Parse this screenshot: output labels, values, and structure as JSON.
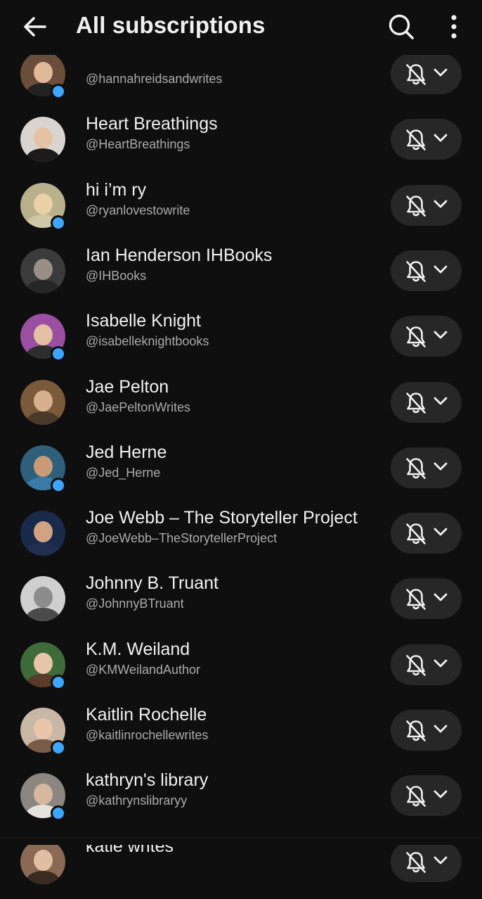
{
  "header": {
    "title": "All subscriptions",
    "back_icon": "arrow-left-icon",
    "search_icon": "search-icon",
    "more_icon": "more-vertical-icon"
  },
  "colors": {
    "background": "#0f0f0f",
    "pill": "#272727",
    "text_primary": "#f1f1f1",
    "text_secondary": "#aaaaaa",
    "live_dot": "#3ea6ff"
  },
  "subscriptions": [
    {
      "name": "",
      "handle": "@hannahreidsandwrites",
      "new_content": true,
      "avatar_bg": "#6b4d3c",
      "skin": "#e0b99a",
      "body": "#222222"
    },
    {
      "name": "Heart Breathings",
      "handle": "@HeartBreathings",
      "new_content": false,
      "avatar_bg": "#d9d4cf",
      "skin": "#e6c2a4",
      "body": "#1b1b1b"
    },
    {
      "name": "hi i’m ry",
      "handle": "@ryanlovestowrite",
      "new_content": true,
      "avatar_bg": "#b9b08c",
      "skin": "#ead0a6",
      "body": "#cfc7a8"
    },
    {
      "name": "Ian Henderson IHBooks",
      "handle": "@IHBooks",
      "new_content": false,
      "avatar_bg": "#3b3b3b",
      "skin": "#9a8f86",
      "body": "#262626"
    },
    {
      "name": "Isabelle Knight",
      "handle": "@isabelleknightbooks",
      "new_content": true,
      "avatar_bg": "#9a4fa0",
      "skin": "#e3c0a3",
      "body": "#2d2d2d"
    },
    {
      "name": "Jae Pelton",
      "handle": "@JaePeltonWrites",
      "new_content": false,
      "avatar_bg": "#7a5a3a",
      "skin": "#d9b08f",
      "body": "#4a3a2a"
    },
    {
      "name": "Jed Herne",
      "handle": "@Jed_Herne",
      "new_content": true,
      "avatar_bg": "#2f5f7a",
      "skin": "#c89a78",
      "body": "#3a7aa8"
    },
    {
      "name": "Joe Webb – The Storyteller Project",
      "handle": "@JoeWebb–TheStorytellerProject",
      "new_content": false,
      "avatar_bg": "#1a2a4a",
      "skin": "#d2a382",
      "body": "#202f4f"
    },
    {
      "name": "Johnny B. Truant",
      "handle": "@JohnnyBTruant",
      "new_content": false,
      "avatar_bg": "#cfcfcf",
      "skin": "#8c8c8c",
      "body": "#4a4a4a"
    },
    {
      "name": "K.M. Weiland",
      "handle": "@KMWeilandAuthor",
      "new_content": true,
      "avatar_bg": "#3f6a3a",
      "skin": "#e6c5a8",
      "body": "#5a3a2a"
    },
    {
      "name": "Kaitlin Rochelle",
      "handle": "@kaitlinrochellewrites",
      "new_content": true,
      "avatar_bg": "#c9b7a6",
      "skin": "#e9c6ab",
      "body": "#7a5a48"
    },
    {
      "name": "kathryn's library",
      "handle": "@kathrynslibraryy",
      "new_content": true,
      "avatar_bg": "#8c8680",
      "skin": "#d6b8a0",
      "body": "#e6e2dc"
    },
    {
      "name": "katie writes",
      "handle": "",
      "new_content": false,
      "avatar_bg": "#8a6a55",
      "skin": "#e0bea2",
      "body": "#3a2a22"
    }
  ],
  "row_icons": {
    "bell": "bell-off-icon",
    "chevron": "chevron-down-icon"
  }
}
